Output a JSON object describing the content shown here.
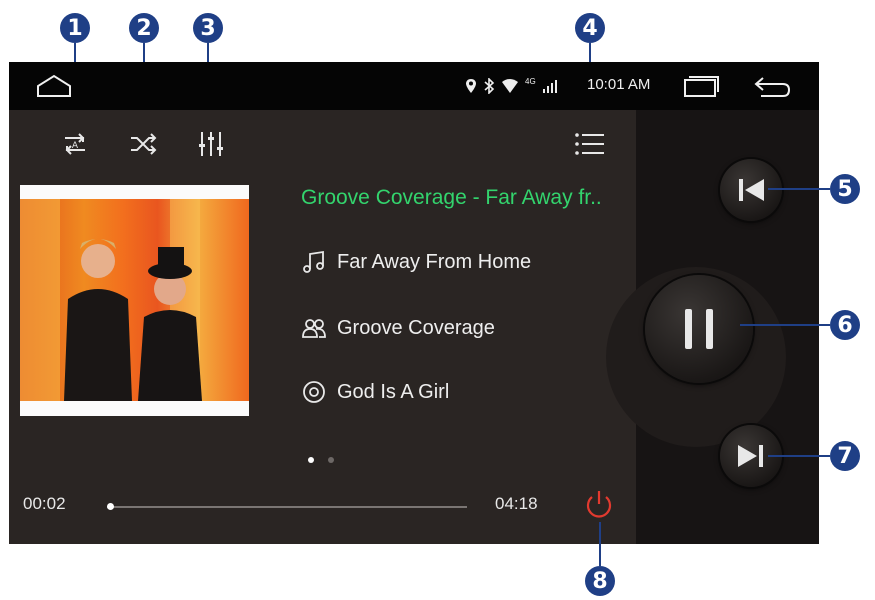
{
  "callouts": [
    "1",
    "2",
    "3",
    "4",
    "5",
    "6",
    "7",
    "8"
  ],
  "status_bar": {
    "time": "10:01 AM",
    "icons": [
      "home-icon",
      "location-icon",
      "bluetooth-icon",
      "wifi-icon",
      "signal-icon",
      "recent-apps-icon",
      "back-icon"
    ],
    "network_badge": "4G"
  },
  "toolbar": {
    "icons": [
      "repeat-mode-icon",
      "shuffle-icon",
      "equalizer-icon",
      "playlist-icon"
    ]
  },
  "now_playing": {
    "header": "Groove Coverage - Far Away fr..",
    "title": "Far Away From Home",
    "artist": "Groove Coverage",
    "album": "God Is A Girl",
    "page_dots": 2,
    "active_page": 1
  },
  "progress": {
    "elapsed": "00:02",
    "duration": "04:18",
    "fraction": 0.008
  },
  "controls": {
    "icons": [
      "previous-icon",
      "pause-icon",
      "next-icon",
      "power-icon"
    ]
  },
  "colors": {
    "accent_green": "#33d46d",
    "power_red": "#e23a2f",
    "callout_blue": "#1f3f86",
    "background": "#2a2523"
  }
}
